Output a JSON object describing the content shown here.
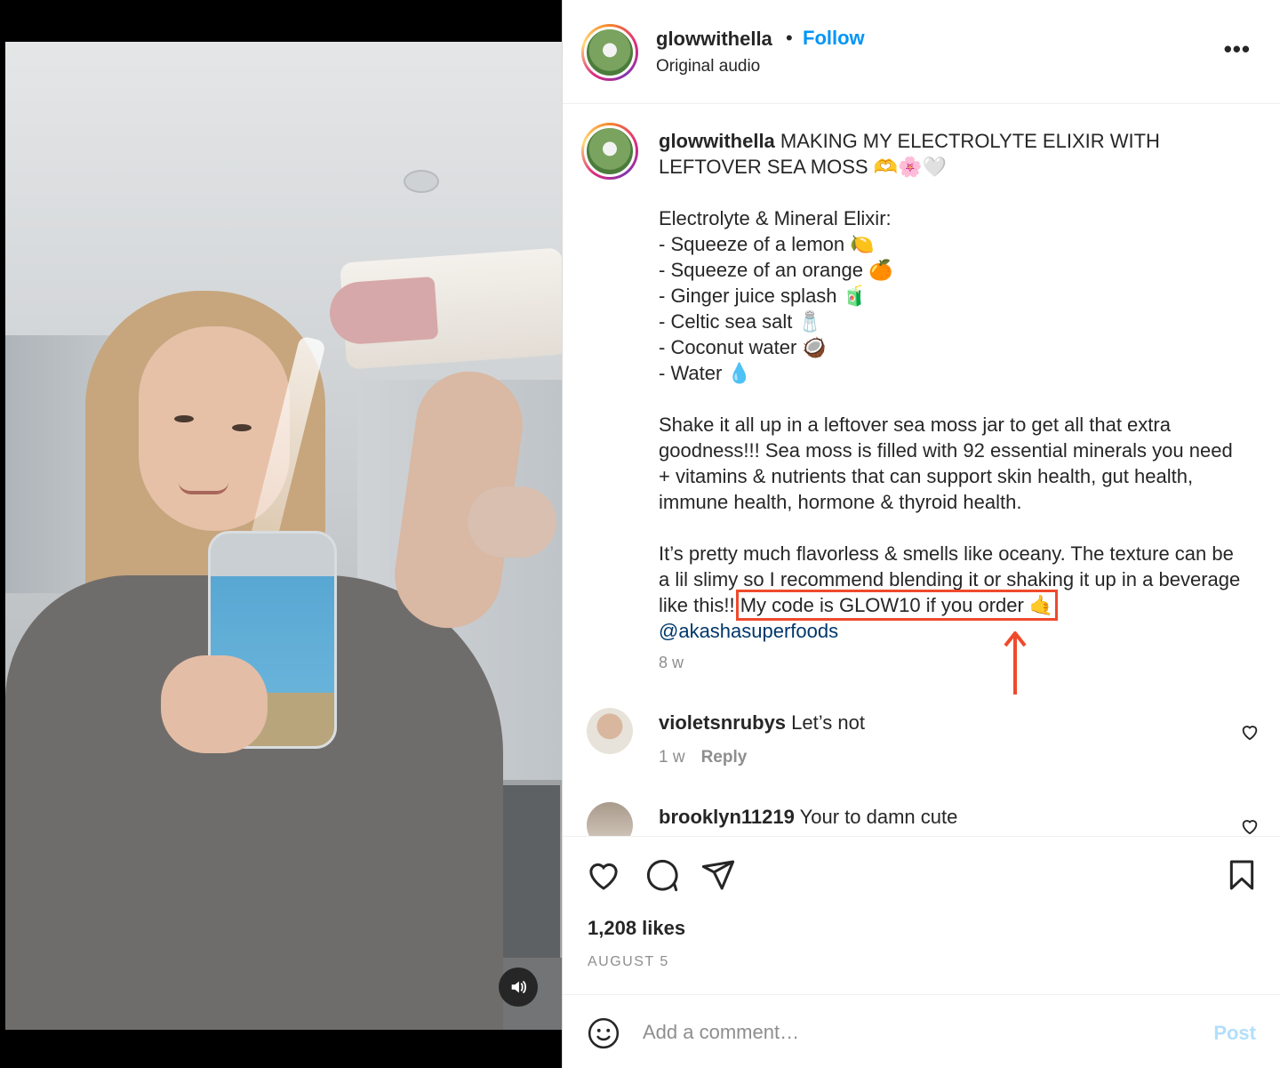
{
  "post": {
    "username": "glowwithella",
    "separator": "•",
    "follow_label": "Follow",
    "audio": "Original audio",
    "more_label": "•••"
  },
  "caption": {
    "username": "glowwithella",
    "line1": " MAKING MY ELECTROLYTE ELIXIR WITH LEFTOVER SEA MOSS 🫶🌸🤍",
    "recipe_title": "Electrolyte & Mineral Elixir:",
    "recipe_items": [
      "- Squeeze of a lemon 🍋",
      "- Squeeze of an orange 🍊",
      "- Ginger juice splash 🧃",
      "- Celtic sea salt 🧂",
      "- Coconut water 🥥",
      "- Water 💧"
    ],
    "paragraph1": "Shake it all up in a leftover sea moss jar to get all that extra goodness!!! Sea moss is filled with 92 essential minerals you need + vitamins & nutrients that can support skin health, gut health, immune health, hormone & thyroid health.",
    "paragraph2_start": "It’s pretty much flavorless & smells like oceany. The texture can be a lil slimy so I recommend blending it or shaking it up in a beverage like this!!!",
    "code_text": "My code is GLOW10 if you order 🤙",
    "mention": "@akashasuperfoods",
    "time": "8 w"
  },
  "comments": [
    {
      "username": "violetsnrubys",
      "text": "Let’s not",
      "time": "1 w",
      "reply": "Reply"
    },
    {
      "username": "brooklyn11219",
      "text": "Your to damn cute"
    }
  ],
  "actions": {
    "likes": "1,208 likes",
    "date": "AUGUST 5"
  },
  "add_comment": {
    "placeholder": "Add a comment…",
    "post_label": "Post"
  },
  "colors": {
    "follow_blue": "#0095f6",
    "highlight_red": "#ef4a2c",
    "mention_blue": "#00376b"
  }
}
